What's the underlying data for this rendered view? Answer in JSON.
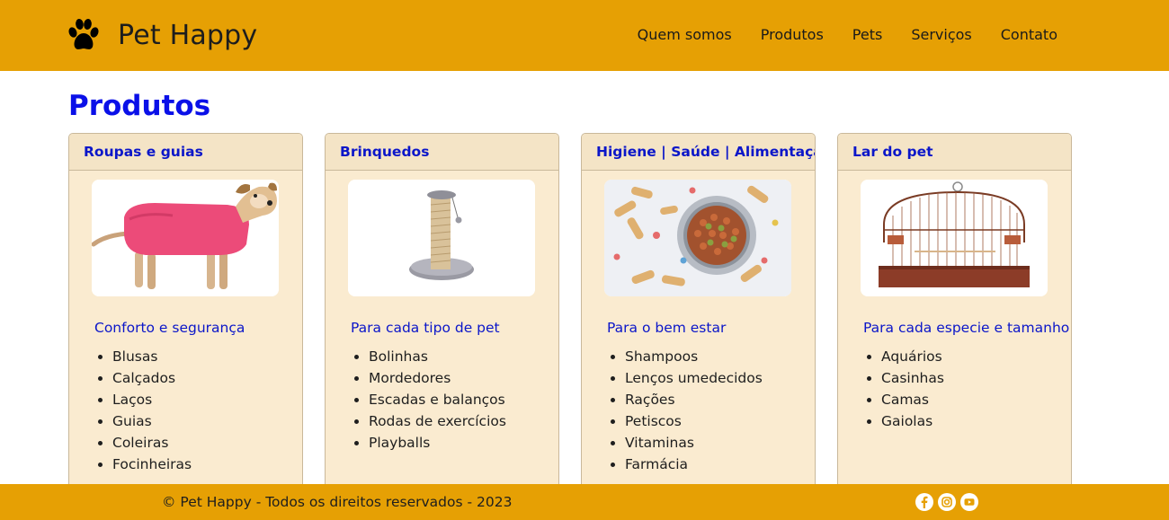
{
  "brand": {
    "name": "Pet Happy",
    "icon": "paw-icon"
  },
  "nav": {
    "items": [
      "Quem somos",
      "Produtos",
      "Pets",
      "Serviços",
      "Contato"
    ]
  },
  "page": {
    "title": "Produtos"
  },
  "cards": [
    {
      "title": "Roupas e guias",
      "image": "dog-in-pink-shirt-image",
      "subtitle": "Conforto e segurança",
      "items": [
        "Blusas",
        "Calçados",
        "Laços",
        "Guias",
        "Coleiras",
        "Focinheiras"
      ]
    },
    {
      "title": "Brinquedos",
      "image": "cat-scratching-post-image",
      "subtitle": "Para cada tipo de pet",
      "items": [
        "Bolinhas",
        "Mordedores",
        "Escadas e balanços",
        "Rodas de exercícios",
        "Playballs"
      ]
    },
    {
      "title": "Higiene | Saúde | Alimentação",
      "image": "pet-food-bowl-image",
      "subtitle": "Para o bem estar",
      "items": [
        "Shampoos",
        "Lenços umedecidos",
        "Rações",
        "Petiscos",
        "Vitaminas",
        "Farmácia"
      ]
    },
    {
      "title": "Lar do pet",
      "image": "bird-cage-image",
      "subtitle": "Para cada especie e tamanho",
      "items": [
        "Aquários",
        "Casinhas",
        "Camas",
        "Gaiolas"
      ]
    }
  ],
  "footer": {
    "text": "© Pet Happy - Todos os direitos reservados - 2023",
    "social": [
      "facebook-icon",
      "instagram-icon",
      "youtube-icon"
    ]
  },
  "colors": {
    "bar": "#e6a004",
    "heading": "#0a10e8",
    "card_bg": "#faebd0",
    "card_header_bg": "#f4e4c6"
  }
}
